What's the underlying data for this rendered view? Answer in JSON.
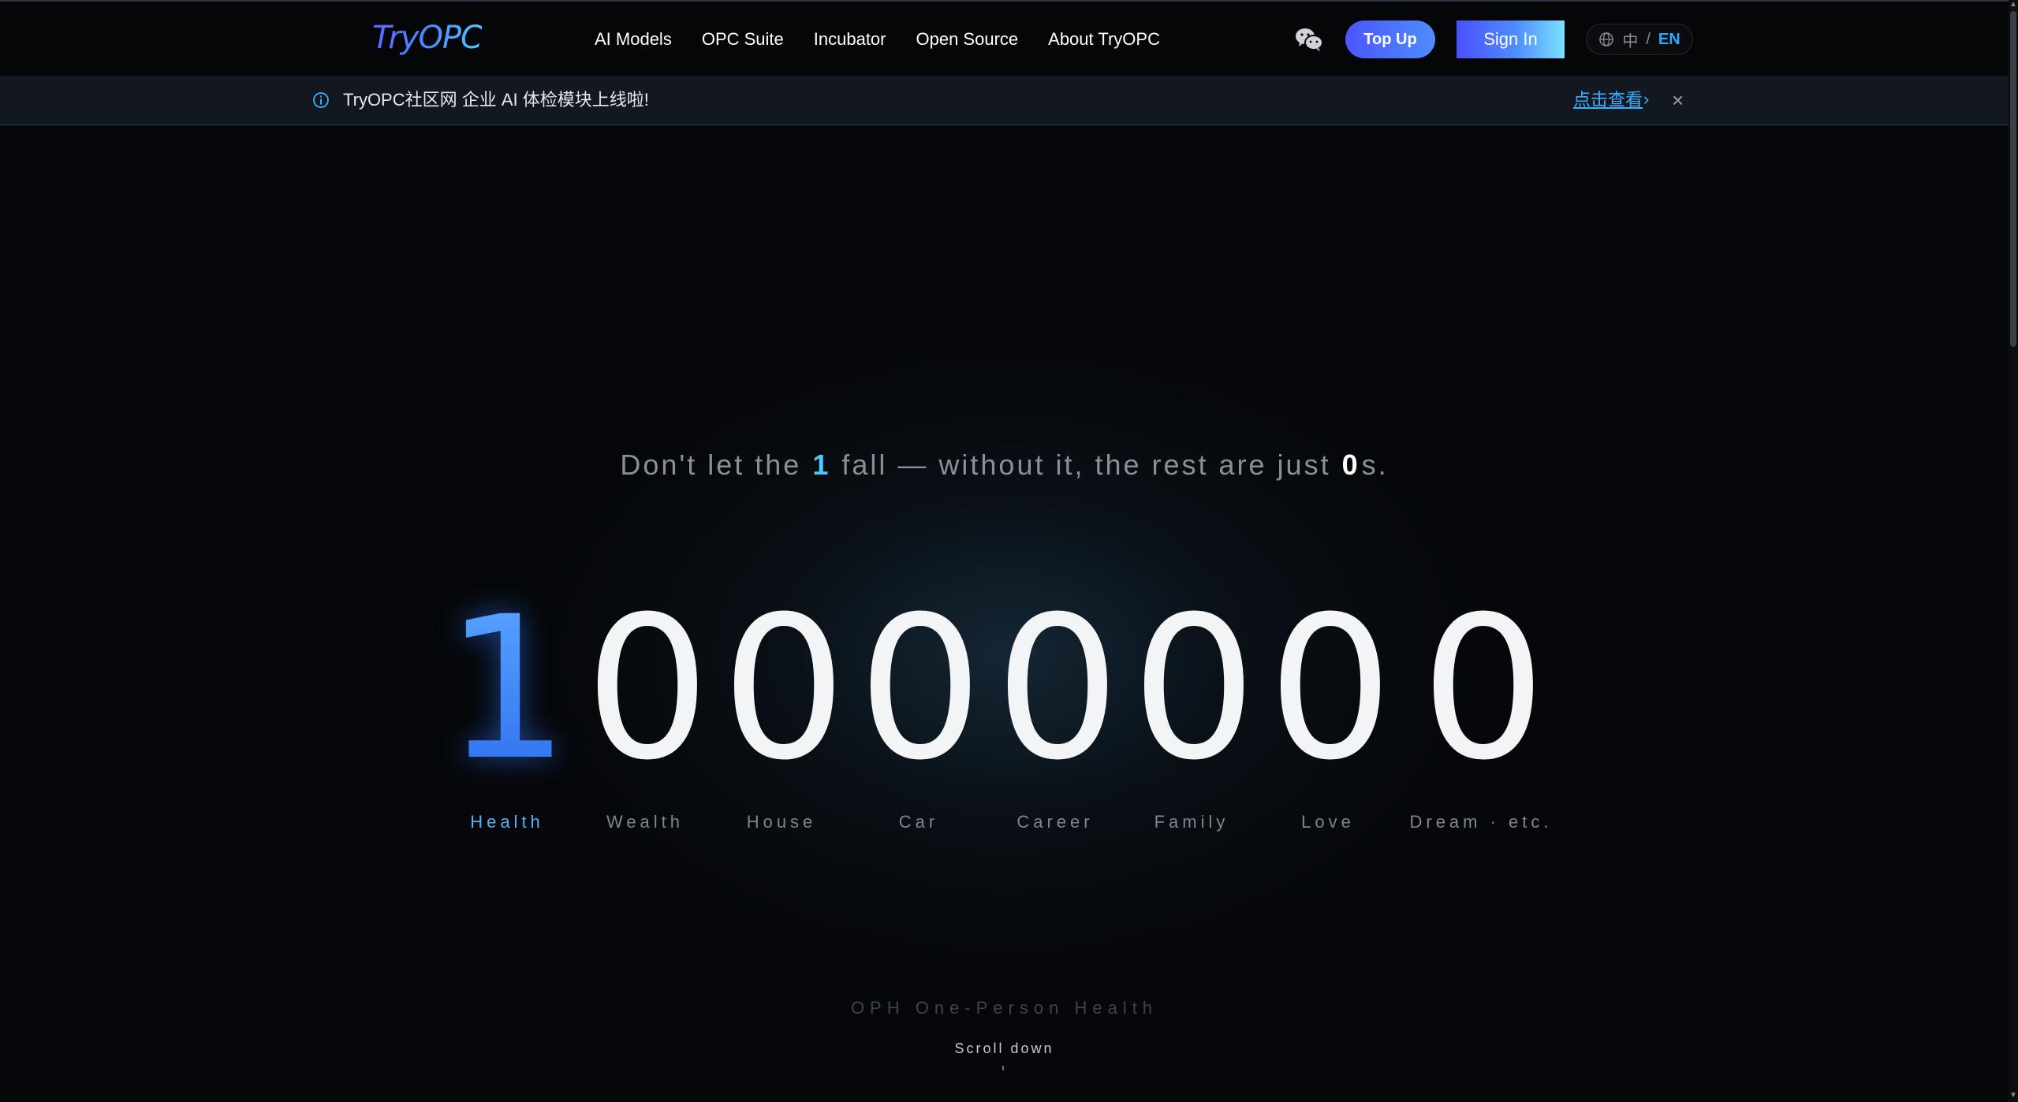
{
  "header": {
    "logo": "TryOPC",
    "nav": [
      "AI Models",
      "OPC Suite",
      "Incubator",
      "Open Source",
      "About TryOPC"
    ],
    "wechat_icon": "wechat-icon",
    "topup_label": "Top Up",
    "signin_label": "Sign In",
    "lang": {
      "zh": "中",
      "sep": "/",
      "en": "EN"
    }
  },
  "announcement": {
    "text": "TryOPC社区网 企业 AI 体检模块上线啦!",
    "link": "点击查看",
    "chevron": "›",
    "close": "×"
  },
  "hero": {
    "tagline_pre": "Don't let the",
    "tagline_one": "1",
    "tagline_mid": "fall — without it, the rest are just",
    "tagline_zero": "0",
    "tagline_post": "s.",
    "digits": [
      "1",
      "0",
      "0",
      "0",
      "0",
      "0",
      "0",
      "0"
    ],
    "labels": [
      "Health",
      "Wealth",
      "House",
      "Car",
      "Career",
      "Family",
      "Love",
      "Dream · etc."
    ],
    "oph": "OPH One-Person Health",
    "scroll_hint": "Scroll down"
  },
  "colors": {
    "accent_blue": "#3a7cf2",
    "accent_cyan": "#4cc8ff",
    "background": "#05070a"
  }
}
